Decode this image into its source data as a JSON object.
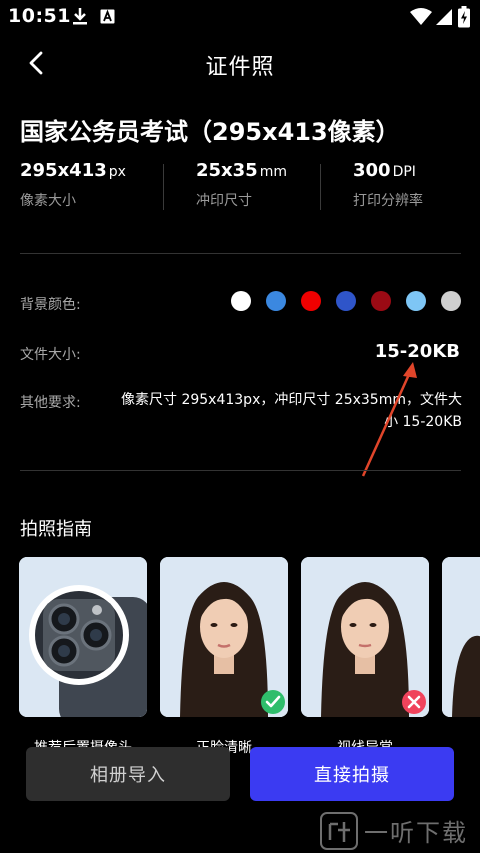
{
  "status": {
    "time": "10:51",
    "icons": [
      "download-icon",
      "keyboard-a-icon",
      "wifi-icon",
      "signal-icon",
      "battery-charging-icon"
    ]
  },
  "nav": {
    "back_icon": "chevron-left-icon",
    "title": "证件照"
  },
  "main_title": "国家公务员考试（295x413像素）",
  "specs": [
    {
      "value": "295x413",
      "unit": "px",
      "label": "像素大小"
    },
    {
      "value": "25x35",
      "unit": "mm",
      "label": "冲印尺寸"
    },
    {
      "value": "300",
      "unit": "DPI",
      "label": "打印分辨率"
    }
  ],
  "background": {
    "label": "背景颜色:",
    "colors": [
      "#ffffff",
      "#3b88e0",
      "#f00000",
      "#2f55c9",
      "#9b0a14",
      "#7ec6f5",
      "#cfcfcf"
    ]
  },
  "file_size": {
    "label": "文件大小:",
    "value": "15-20KB"
  },
  "other": {
    "label": "其他要求:",
    "value": "像素尺寸 295x413px，冲印尺寸 25x35mm，文件大小 15-20KB"
  },
  "guide": {
    "title": "拍照指南",
    "cards": [
      {
        "caption": "推荐后置摄像头",
        "icon": "rear-camera-icon"
      },
      {
        "caption": "正脸清晰",
        "icon": "check-icon"
      },
      {
        "caption": "视线异常",
        "icon": "cross-icon"
      }
    ]
  },
  "buttons": {
    "album": "相册导入",
    "shoot": "直接拍摄"
  },
  "watermark": "一听下载",
  "colors": {
    "accent": "#3b3bf2",
    "annotation_arrow": "#e0452a"
  }
}
